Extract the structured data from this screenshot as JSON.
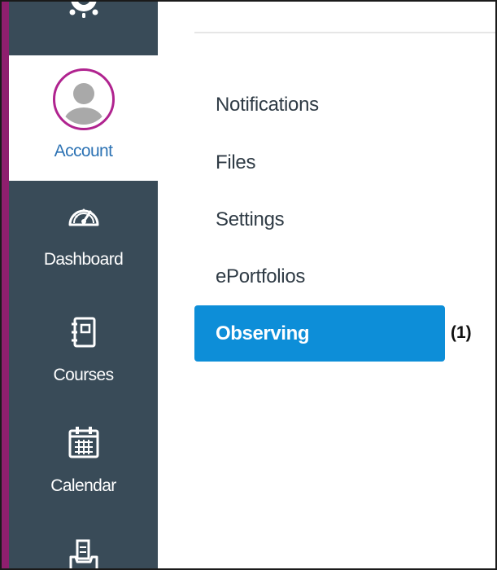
{
  "nav": {
    "items": [
      {
        "label": "Account",
        "icon": "user-avatar-icon",
        "active": true
      },
      {
        "label": "Dashboard",
        "icon": "speedometer-icon",
        "active": false
      },
      {
        "label": "Courses",
        "icon": "notebook-icon",
        "active": false
      },
      {
        "label": "Calendar",
        "icon": "calendar-icon",
        "active": false
      },
      {
        "label": "",
        "icon": "inbox-icon",
        "active": false
      }
    ],
    "colors": {
      "background": "#394b58",
      "accent": "#8e1f6e",
      "active_text": "#2d73b4"
    }
  },
  "account_menu": {
    "links": [
      {
        "label": "Notifications"
      },
      {
        "label": "Files"
      },
      {
        "label": "Settings"
      },
      {
        "label": "ePortfolios"
      }
    ],
    "active": {
      "label": "Observing",
      "color": "#0d8ed8"
    },
    "callout": "(1)"
  }
}
